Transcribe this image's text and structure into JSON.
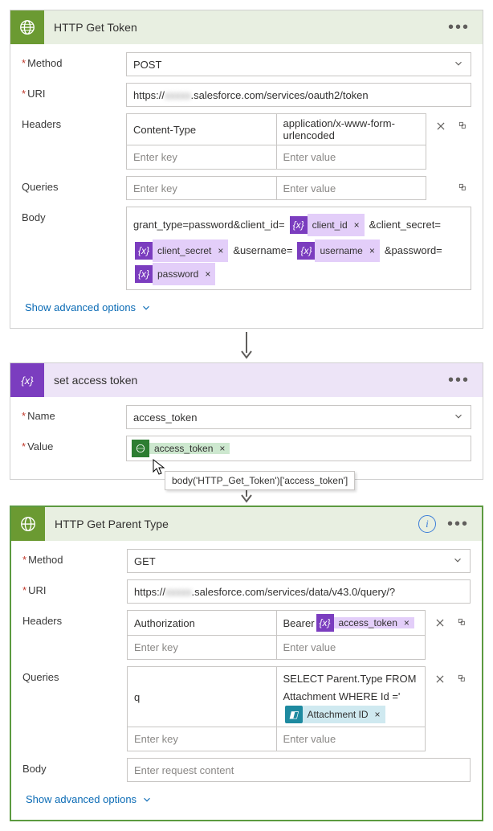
{
  "colors": {
    "http": "#6b9a32",
    "variable": "#7b3dbf"
  },
  "httpGetToken": {
    "title": "HTTP Get Token",
    "method": {
      "label": "Method",
      "value": "POST"
    },
    "uri": {
      "label": "URI",
      "prefix": "https://",
      "redacted": "xxxxx",
      "suffix": ".salesforce.com/services/oauth2/token"
    },
    "headers": {
      "label": "Headers",
      "rows": [
        {
          "key": "Content-Type",
          "value": "application/x-www-form-urlencoded"
        }
      ],
      "placeholderKey": "Enter key",
      "placeholderValue": "Enter value"
    },
    "queries": {
      "label": "Queries",
      "placeholderKey": "Enter key",
      "placeholderValue": "Enter value"
    },
    "body": {
      "label": "Body",
      "segments": [
        {
          "t": "text",
          "v": "grant_type=password&client_id="
        },
        {
          "t": "token",
          "style": "purple",
          "name": "client_id"
        },
        {
          "t": "text",
          "v": "&client_secret="
        },
        {
          "t": "token",
          "style": "purple",
          "name": "client_secret"
        },
        {
          "t": "text",
          "v": "&username="
        },
        {
          "t": "token",
          "style": "purple",
          "name": "username"
        },
        {
          "t": "text",
          "v": "&password="
        },
        {
          "t": "token",
          "style": "purple",
          "name": "password"
        }
      ]
    },
    "advanced": "Show advanced options"
  },
  "setAccessToken": {
    "title": "set access token",
    "name": {
      "label": "Name",
      "value": "access_token"
    },
    "value": {
      "label": "Value",
      "token": {
        "style": "green",
        "name": "access_token"
      }
    },
    "tooltip": "body('HTTP_Get_Token')['access_token']"
  },
  "httpGetParentType": {
    "title": "HTTP Get Parent Type",
    "method": {
      "label": "Method",
      "value": "GET"
    },
    "uri": {
      "label": "URI",
      "prefix": "https://",
      "redacted": "xxxxx",
      "suffix": ".salesforce.com/services/data/v43.0/query/?"
    },
    "headers": {
      "label": "Headers",
      "rows": [
        {
          "key": "Authorization",
          "valuePrefix": "Bearer ",
          "token": {
            "style": "purple",
            "name": "access_token"
          }
        }
      ],
      "placeholderKey": "Enter key",
      "placeholderValue": "Enter value"
    },
    "queries": {
      "label": "Queries",
      "rows": [
        {
          "key": "q",
          "valuePrefix": "SELECT Parent.Type FROM Attachment WHERE Id ='",
          "token": {
            "style": "teal",
            "name": "Attachment ID"
          }
        }
      ],
      "placeholderKey": "Enter key",
      "placeholderValue": "Enter value"
    },
    "body": {
      "label": "Body",
      "placeholder": "Enter request content"
    },
    "advanced": "Show advanced options"
  }
}
